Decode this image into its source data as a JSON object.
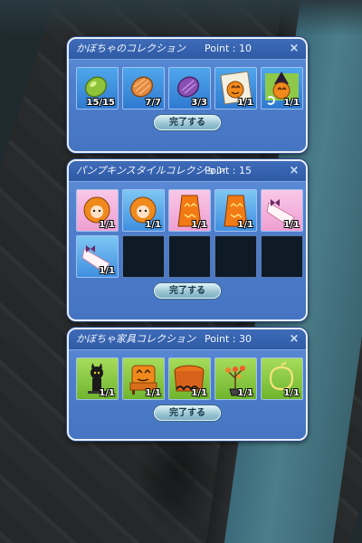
{
  "panels": [
    {
      "title": "かぼちゃのコレクション",
      "point": "Point : 10",
      "close": "×",
      "button": "完了する",
      "slots": [
        {
          "icon": "green-seed-icon",
          "count": "15/15"
        },
        {
          "icon": "orange-seed-icon",
          "count": "7/7"
        },
        {
          "icon": "purple-seed-icon",
          "count": "3/3"
        },
        {
          "icon": "pumpkin-poster-icon",
          "count": "1/1"
        },
        {
          "icon": "witch-hat-pumpkin-icon",
          "count": "1/1"
        }
      ]
    },
    {
      "title": "パンプキンスタイルコレクション",
      "point": "Point : 15",
      "close": "×",
      "button": "完了する",
      "slots": [
        {
          "icon": "pumpkin-hair-icon",
          "count": "1/1"
        },
        {
          "icon": "pumpkin-hair-icon",
          "count": "1/1"
        },
        {
          "icon": "jack-o-lantern-dress-icon",
          "count": "1/1"
        },
        {
          "icon": "jack-o-lantern-dress-icon",
          "count": "1/1"
        },
        {
          "icon": "ribbon-scroll-icon",
          "count": "1/1"
        },
        {
          "icon": "ribbon-scroll-icon",
          "count": "1/1"
        },
        {
          "icon": "",
          "count": ""
        },
        {
          "icon": "",
          "count": ""
        },
        {
          "icon": "",
          "count": ""
        },
        {
          "icon": "",
          "count": ""
        }
      ]
    },
    {
      "title": "かぼちゃ家具コレクション",
      "point": "Point : 30",
      "close": "×",
      "button": "完了する",
      "slots": [
        {
          "icon": "black-cat-lamp-icon",
          "count": "1/1"
        },
        {
          "icon": "pumpkin-chair-icon",
          "count": "1/1"
        },
        {
          "icon": "halloween-table-icon",
          "count": "1/1"
        },
        {
          "icon": "potted-flower-icon",
          "count": "1/1"
        },
        {
          "icon": "pumpkin-outline-icon",
          "count": "1/1"
        }
      ]
    }
  ],
  "colors": {
    "panel": "#4f7fcc",
    "header": "#2e5aa6",
    "slot": "#3f8fe0",
    "empty_slot": "#0e1a26",
    "button": "#9cc6d3"
  }
}
